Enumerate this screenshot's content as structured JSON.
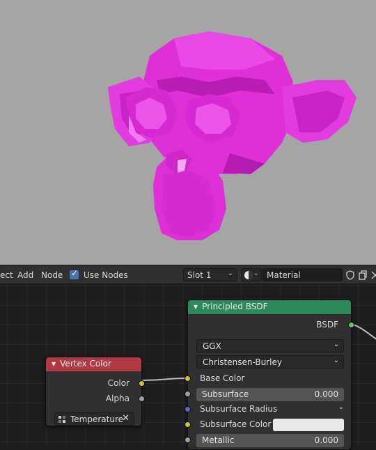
{
  "header": {
    "menu": [
      "ect",
      "Add",
      "Node"
    ],
    "use_nodes_label": "Use Nodes",
    "use_nodes_checked": true,
    "slot_label": "Slot 1",
    "material_name": "Material"
  },
  "colors": {
    "viewport_bg": "#a5a5a5",
    "mesh_color": "#de2fd9",
    "principled_header": "#2c8a5a",
    "vertex_color_header": "#b03a43"
  },
  "nodes": {
    "principled": {
      "title": "Principled BSDF",
      "output_label": "BSDF",
      "distribution": "GGX",
      "subsurface_method": "Christensen-Burley",
      "inputs": {
        "base_color": "Base Color",
        "subsurface": {
          "label": "Subsurface",
          "value": "0.000"
        },
        "subsurface_radius": "Subsurface Radius",
        "subsurface_color": "Subsurface Color",
        "metallic": {
          "label": "Metallic",
          "value": "0.000"
        }
      }
    },
    "vertex_color": {
      "title": "Vertex Color",
      "outputs": [
        "Color",
        "Alpha"
      ],
      "layer": "Temperature"
    }
  }
}
